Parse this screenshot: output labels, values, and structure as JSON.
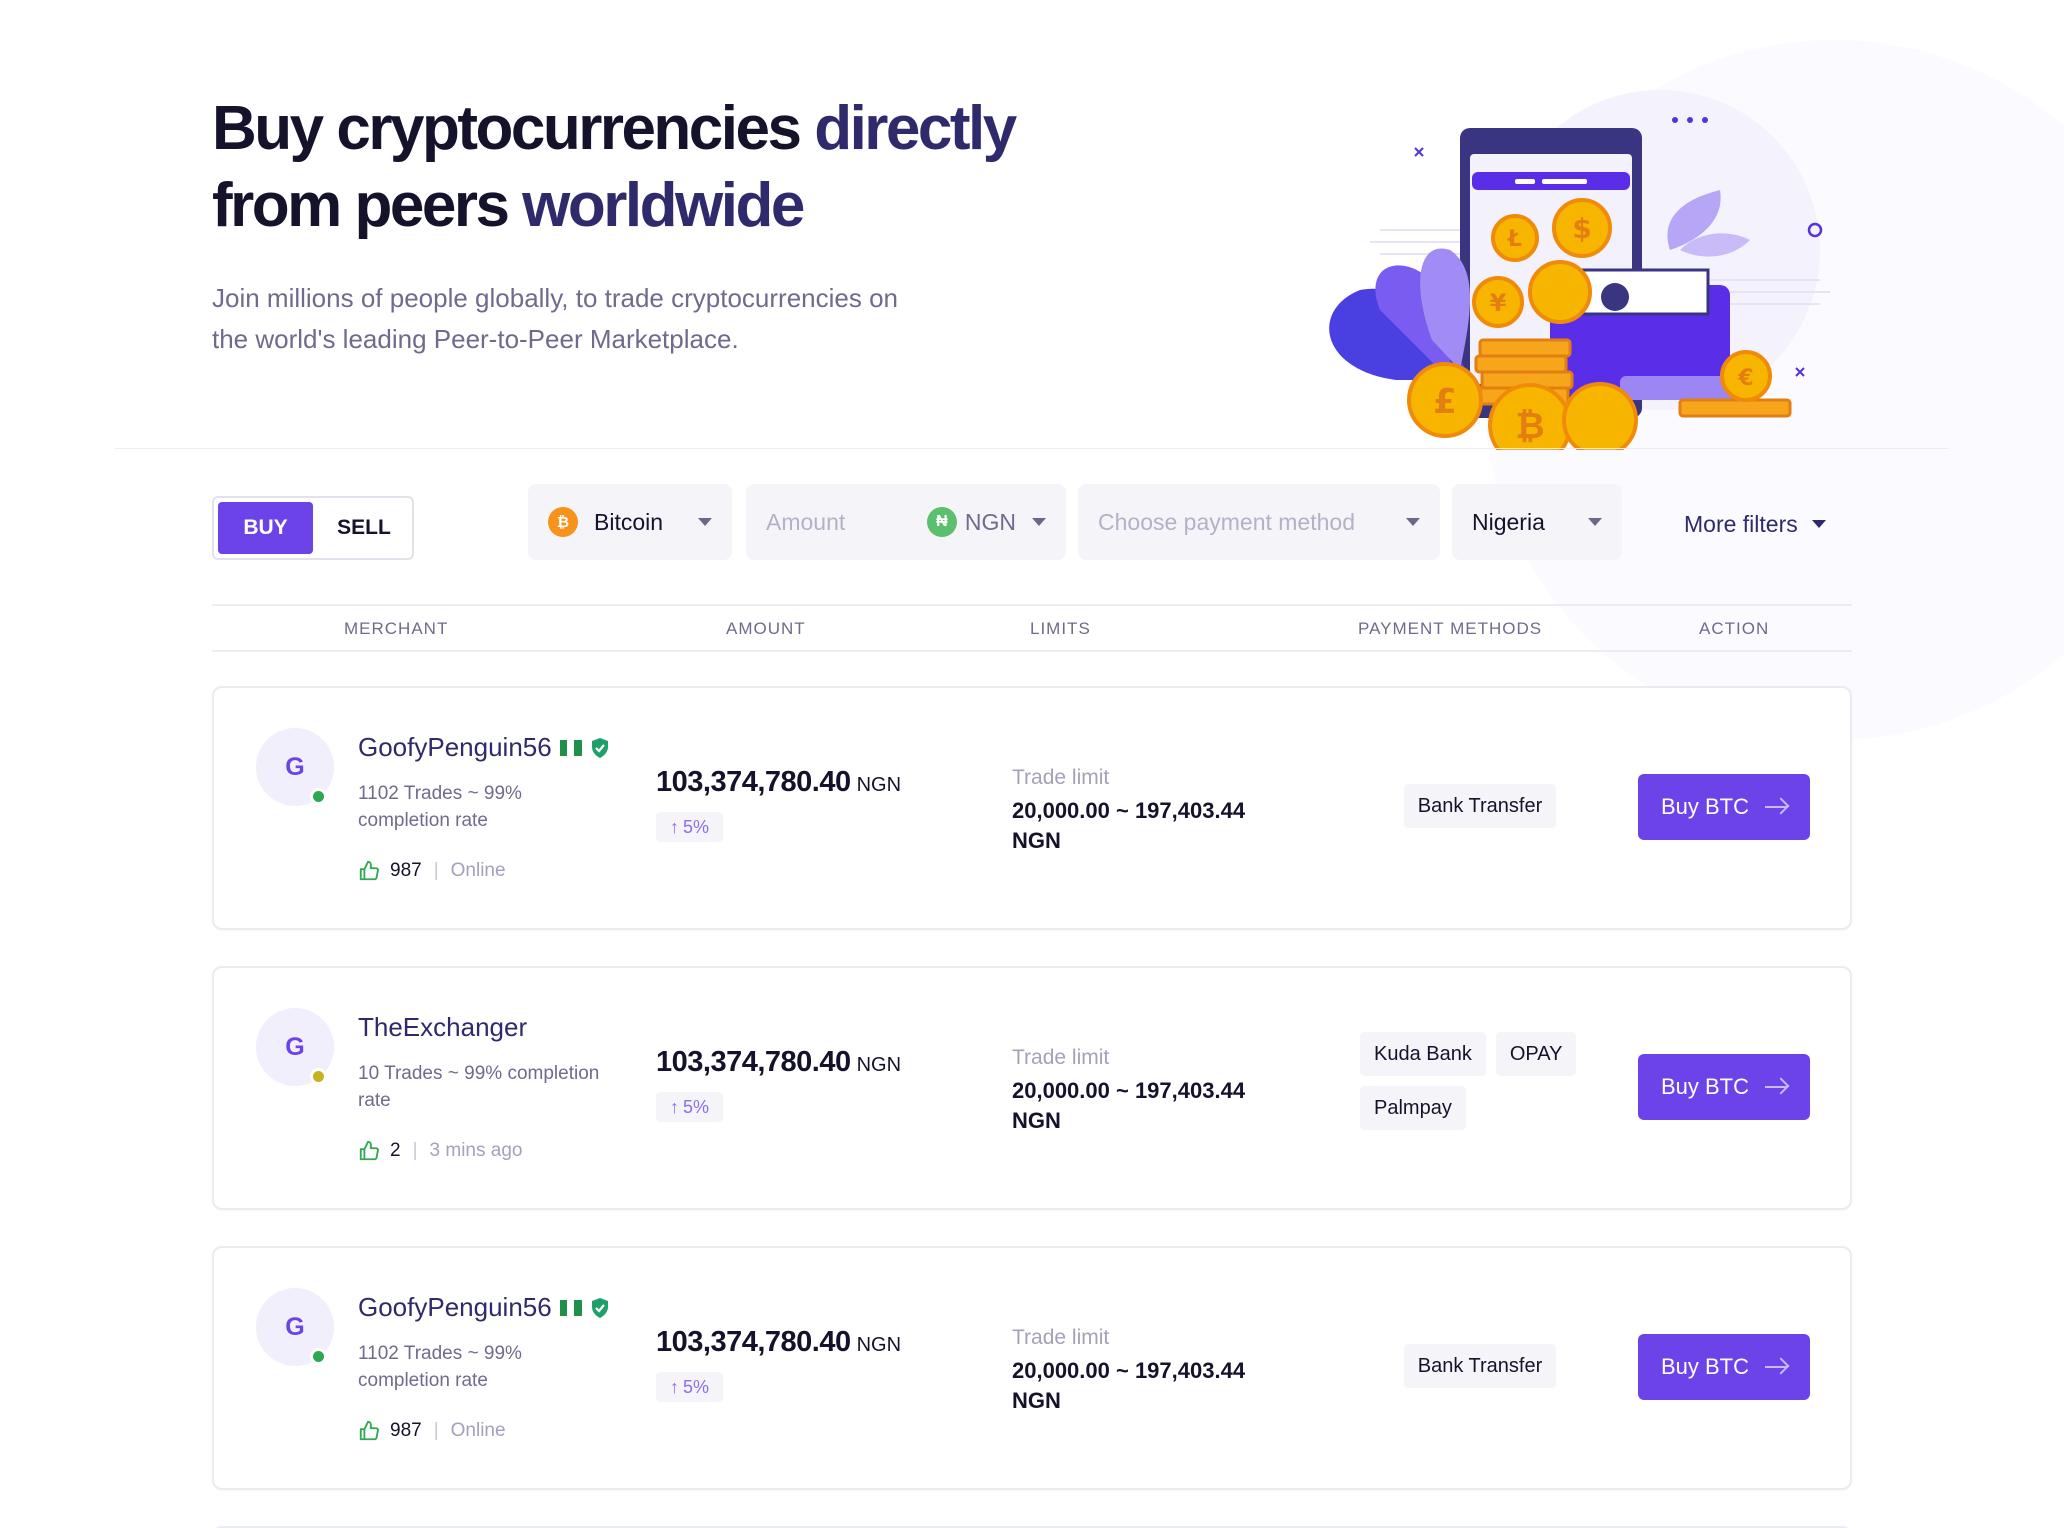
{
  "hero": {
    "title_line1_a": "Buy cryptocurrencies ",
    "title_line1_b": "directly",
    "title_line2_a": "from peers ",
    "title_line2_b": "worldwide",
    "subtitle": "Join millions of people globally, to trade cryptocurrencies on the world's leading Peer-to-Peer Marketplace."
  },
  "toggle": {
    "buy": "BUY",
    "sell": "SELL",
    "active": "BUY"
  },
  "filters": {
    "coin": {
      "label": "Bitcoin",
      "icon": "bitcoin-icon",
      "color": "#f7931a"
    },
    "amount": {
      "placeholder": "Amount",
      "currency": "NGN",
      "currency_symbol": "₦",
      "currency_color": "#5bbf6e"
    },
    "payment_method": {
      "placeholder": "Choose payment method"
    },
    "country": {
      "label": "Nigeria"
    },
    "more": "More filters"
  },
  "table": {
    "headers": {
      "merchant": "MERCHANT",
      "amount": "AMOUNT",
      "limits": "LIMITS",
      "payment_methods": "PAYMENT METHODS",
      "action": "ACTION"
    }
  },
  "offers": [
    {
      "initial": "G",
      "name": "GoofyPenguin56",
      "verified": true,
      "status_color": "#2fa84f",
      "stats": "1102 Trades ~ 99% completion rate",
      "likes": "987",
      "presence": "Online",
      "amount": "103,374,780.40",
      "currency": "NGN",
      "change": "5%",
      "limit_label": "Trade limit",
      "limit_value": "20,000.00 ~ 197,403.44 NGN",
      "methods": [
        "Bank Transfer"
      ],
      "action": "Buy BTC"
    },
    {
      "initial": "G",
      "name": "TheExchanger",
      "verified": false,
      "status_color": "#c9b21f",
      "stats": "10 Trades ~ 99% completion rate",
      "likes": "2",
      "presence": "3 mins ago",
      "amount": "103,374,780.40",
      "currency": "NGN",
      "change": "5%",
      "limit_label": "Trade limit",
      "limit_value": "20,000.00 ~ 197,403.44 NGN",
      "methods": [
        "Kuda Bank",
        "OPAY",
        "Palmpay"
      ],
      "action": "Buy BTC"
    },
    {
      "initial": "G",
      "name": "GoofyPenguin56",
      "verified": true,
      "status_color": "#2fa84f",
      "stats": "1102 Trades ~ 99% completion rate",
      "likes": "987",
      "presence": "Online",
      "amount": "103,374,780.40",
      "currency": "NGN",
      "change": "5%",
      "limit_label": "Trade limit",
      "limit_value": "20,000.00 ~ 197,403.44 NGN",
      "methods": [
        "Bank Transfer"
      ],
      "action": "Buy BTC"
    }
  ],
  "colors": {
    "accent": "#6b43e8",
    "navy": "#2e2a6b",
    "positive": "#2fa84f"
  }
}
